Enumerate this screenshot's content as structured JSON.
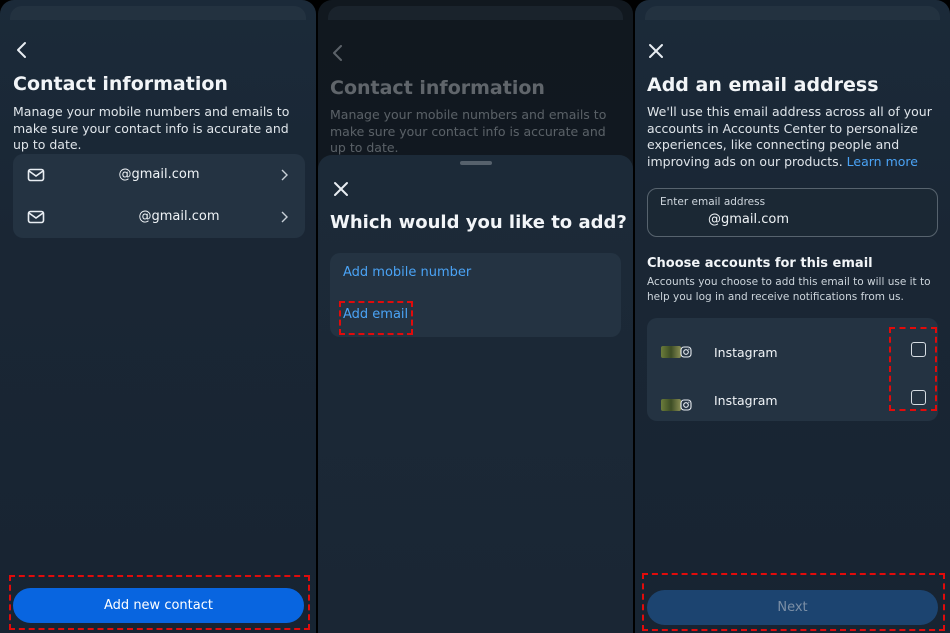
{
  "screen1": {
    "title": "Contact information",
    "description": "Manage your mobile numbers and emails to make sure your contact info is accurate and up to date.",
    "contacts": [
      {
        "icon": "mail-icon",
        "value": "@gmail.com"
      },
      {
        "icon": "mail-icon",
        "value": "@gmail.com"
      }
    ],
    "primary_button": "Add new contact"
  },
  "screen2": {
    "background_title": "Contact information",
    "background_description": "Manage your mobile numbers and emails to make sure your contact info is accurate and up to date.",
    "sheet_title": "Which would you like to add?",
    "options": [
      "Add mobile number",
      "Add email"
    ]
  },
  "screen3": {
    "title": "Add an email address",
    "description": "We'll use this email address across all of your accounts in Accounts Center to personalize experiences, like connecting people and improving ads on our products.",
    "learn_more": "Learn more",
    "input_label": "Enter email address",
    "input_value": "@gmail.com",
    "section_title": "Choose accounts for this email",
    "section_description": "Accounts you choose to add this email to will use it to help you log in and receive notifications from us.",
    "accounts": [
      {
        "platform": "Instagram",
        "checked": false
      },
      {
        "platform": "Instagram",
        "checked": false
      }
    ],
    "next_button": "Next"
  },
  "colors": {
    "accent": "#0865e0",
    "link": "#4aa3f5",
    "highlight": "#e10b0b",
    "panel_bg": "#1b2a39"
  }
}
